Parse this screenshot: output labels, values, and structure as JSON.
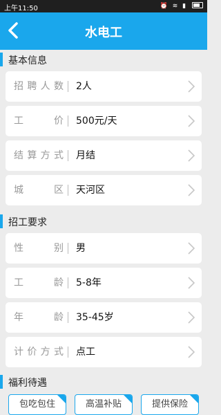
{
  "status_bar": {
    "time": "上午11:50",
    "icons": [
      "alarm-icon",
      "wifi-icon",
      "signal-icon",
      "battery-icon"
    ]
  },
  "header": {
    "title": "水电工",
    "back_icon": "chevron-left-icon"
  },
  "sections": {
    "basic": "基本信息",
    "requirements": "招工要求",
    "benefits": "福利待遇"
  },
  "basic_info": [
    {
      "key": "招聘人数",
      "value": "2人"
    },
    {
      "key": "工价",
      "value": "500元/天"
    },
    {
      "key": "结算方式",
      "value": "月结"
    },
    {
      "key": "城区",
      "value": "天河区"
    }
  ],
  "requirements": [
    {
      "key": "性别",
      "value": "男"
    },
    {
      "key": "工龄",
      "value": "5-8年"
    },
    {
      "key": "年龄",
      "value": "35-45岁"
    },
    {
      "key": "计价方式",
      "value": "点工"
    }
  ],
  "benefits": [
    "包吃包住",
    "高温补贴",
    "提供保险"
  ],
  "colors": {
    "accent": "#1aa7ec",
    "background": "#ececec",
    "card": "#ffffff"
  }
}
